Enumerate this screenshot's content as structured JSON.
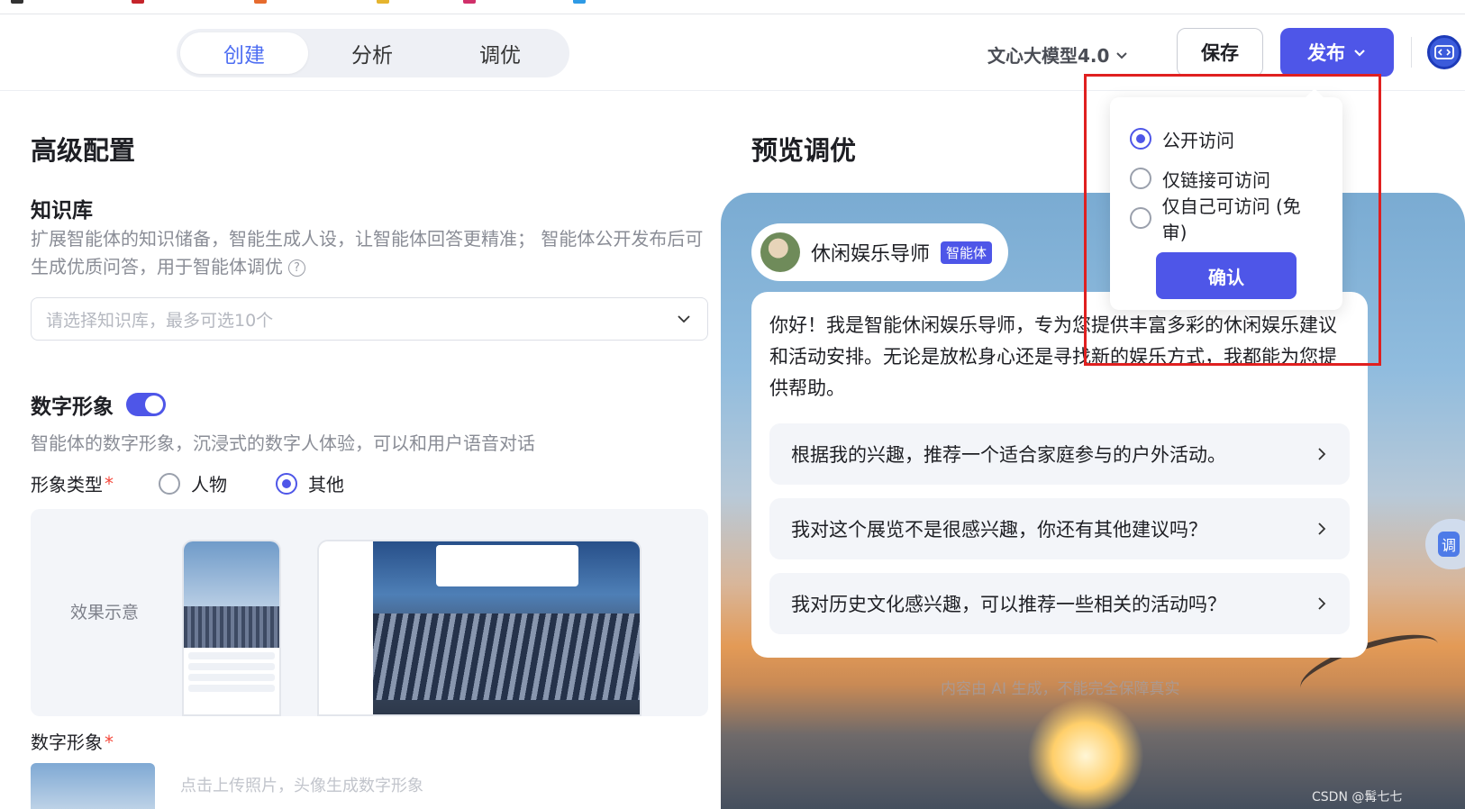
{
  "header": {
    "tabs": [
      {
        "label": "创建",
        "active": true
      },
      {
        "label": "分析",
        "active": false
      },
      {
        "label": "调优",
        "active": false
      }
    ],
    "model": "文心大模型4.0",
    "save_label": "保存",
    "publish_label": "发布"
  },
  "left": {
    "section_title": "高级配置",
    "knowledge": {
      "title": "知识库",
      "desc": "扩展智能体的知识储备，智能生成人设，让智能体回答更精准； 智能体公开发布后可生成优质问答，用于智能体调优",
      "placeholder": "请选择知识库，最多可选10个"
    },
    "digital_human": {
      "title": "数字形象",
      "enabled": true,
      "desc": "智能体的数字形象，沉浸式的数字人体验，可以和用户语音对话",
      "type_label": "形象类型",
      "type_options": [
        {
          "label": "人物",
          "checked": false
        },
        {
          "label": "其他",
          "checked": true
        }
      ],
      "effect_label": "效果示意",
      "image_label": "数字形象",
      "upload_hint": "点击上传照片，头像生成数字形象"
    }
  },
  "right": {
    "title": "预览调优",
    "agent_name": "休闲娱乐导师",
    "agent_badge": "智能体",
    "greeting": "你好！我是智能休闲娱乐导师，专为您提供丰富多彩的休闲娱乐建议和活动安排。无论是放松身心还是寻找新的娱乐方式，我都能为您提供帮助。",
    "suggestions": [
      "根据我的兴趣，推荐一个适合家庭参与的户外活动。",
      "我对这个展览不是很感兴趣，你还有其他建议吗？",
      "我对历史文化感兴趣，可以推荐一些相关的活动吗？"
    ],
    "disclaimer": "内容由 AI 生成，不能完全保障真实",
    "float_label": "调"
  },
  "publish_menu": {
    "options": [
      {
        "label": "公开访问",
        "checked": true
      },
      {
        "label": "仅链接可访问",
        "checked": false
      },
      {
        "label": "仅自己可访问 (免审)",
        "checked": false
      }
    ],
    "confirm_label": "确认"
  },
  "watermark": "CSDN @髯七七",
  "colors": {
    "accent": "#4e56e8",
    "highlight": "#e02020"
  }
}
